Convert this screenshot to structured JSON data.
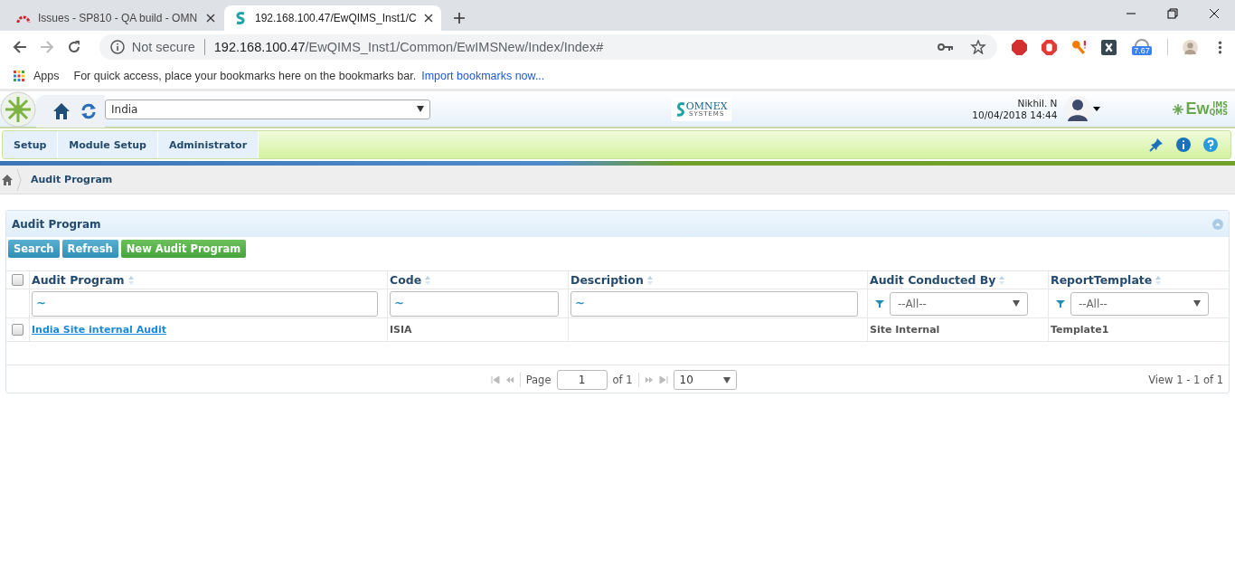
{
  "browser": {
    "tabs": [
      {
        "title": "Issues - SP810 - QA build - OMN",
        "selected": false
      },
      {
        "title": "192.168.100.47/EwQIMS_Inst1/C",
        "selected": true
      }
    ],
    "security": "Not secure",
    "url_host": "192.168.100.47",
    "url_path": "/EwQIMS_Inst1/Common/EwIMSNew/Index/Index#",
    "extension_badge": "7.67",
    "bookmarks": {
      "apps": "Apps",
      "hint": "For quick access, place your bookmarks here on the bookmarks bar.",
      "link": "Import bookmarks now..."
    }
  },
  "app": {
    "site": "India",
    "logo_word": "OMNEX",
    "logo_sub": "SYSTEMS",
    "user": "Nikhil. N",
    "datetime": "10/04/2018 14:44",
    "brand_main": "Ew",
    "brand_top": "IMS",
    "brand_bottom": "QMS",
    "menu": [
      {
        "label": "Setup"
      },
      {
        "label": "Module Setup"
      },
      {
        "label": "Administrator"
      }
    ],
    "breadcrumb": "Audit Program"
  },
  "panel": {
    "title": "Audit Program",
    "buttons": [
      {
        "label": "Search",
        "kind": "blue"
      },
      {
        "label": "Refresh",
        "kind": "blue"
      },
      {
        "label": "New Audit Program",
        "kind": "green"
      }
    ],
    "table": {
      "select_all_checked": false,
      "columns": [
        {
          "title": "Audit Program",
          "kind": "text",
          "filter_value": "~"
        },
        {
          "title": "Code",
          "kind": "text",
          "filter_value": "~"
        },
        {
          "title": "Description",
          "kind": "text",
          "filter_value": "~"
        },
        {
          "title": "Audit Conducted By",
          "kind": "select",
          "filter_value": "--All--"
        },
        {
          "title": "ReportTemplate",
          "kind": "select",
          "filter_value": "--All--"
        }
      ],
      "rows": [
        {
          "checked": false,
          "cells": [
            "India Site internal Audit",
            "ISIA",
            "",
            "Site Internal",
            "Template1"
          ]
        }
      ]
    },
    "pager": {
      "page_label": "Page",
      "page": "1",
      "of": "of 1",
      "page_size": "10",
      "view": "View 1 - 1 of 1"
    }
  }
}
